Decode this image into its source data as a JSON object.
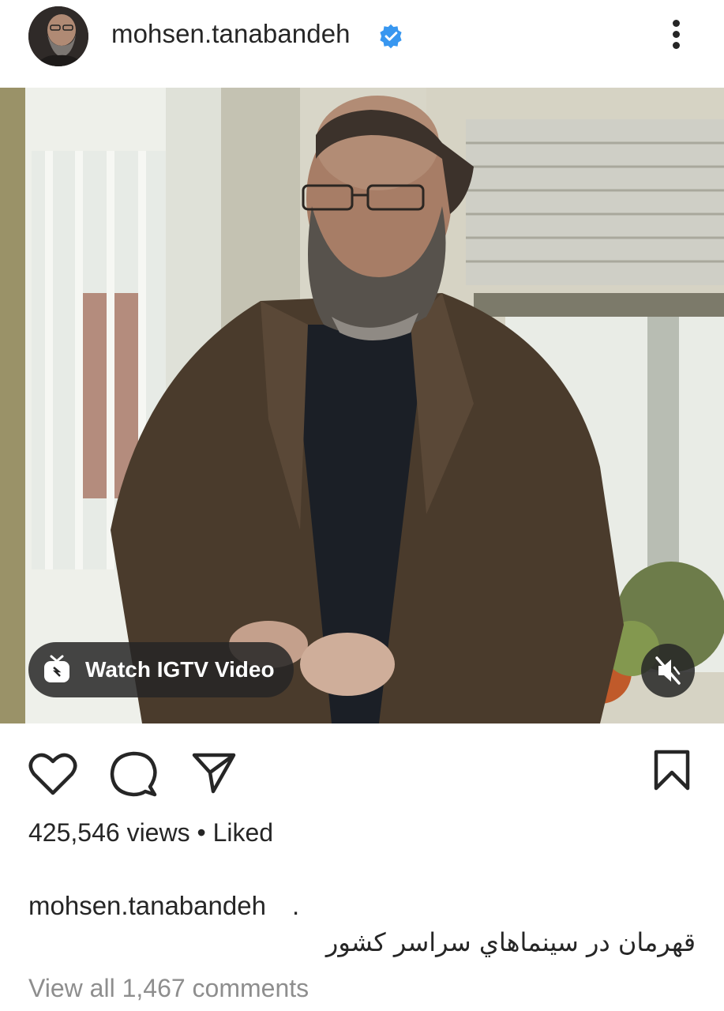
{
  "header": {
    "username": "mohsen.tanabandeh",
    "verified_icon": "verified-badge-icon",
    "more_icon": "more-vertical-icon"
  },
  "media": {
    "igtv_label": "Watch IGTV Video",
    "igtv_icon": "igtv-icon",
    "mute_icon": "muted-speaker-icon"
  },
  "actions": {
    "like_icon": "heart-icon",
    "comment_icon": "comment-icon",
    "share_icon": "send-icon",
    "save_icon": "bookmark-icon"
  },
  "stats": {
    "views_text": "425,546 views • Liked"
  },
  "caption": {
    "username": "mohsen.tanabandeh",
    "dot": ".",
    "text": "قهرمان در سينماهاي سراسر کشور"
  },
  "comments": {
    "view_all": "View all 1,467 comments"
  },
  "colors": {
    "verified": "#3897f0",
    "text": "#262626",
    "muted_text": "#8e8e8e"
  }
}
